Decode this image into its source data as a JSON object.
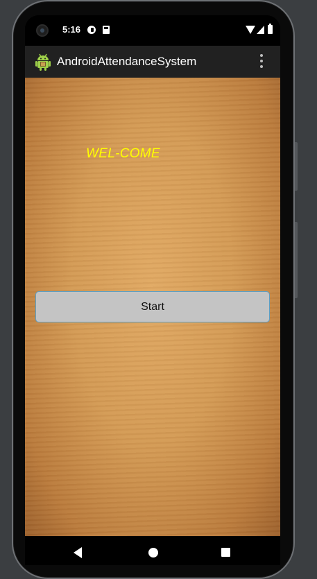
{
  "status_bar": {
    "time": "5:16"
  },
  "action_bar": {
    "title": "AndroidAttendanceSystem",
    "app_icon": "android-icon",
    "overflow_icon": "more-vert-icon"
  },
  "main": {
    "welcome_text": "WEL-COME",
    "start_button_label": "Start",
    "welcome_color": "#ffff00"
  },
  "nav_bar": {
    "back_icon": "back-icon",
    "home_icon": "home-icon",
    "recents_icon": "recents-icon"
  }
}
